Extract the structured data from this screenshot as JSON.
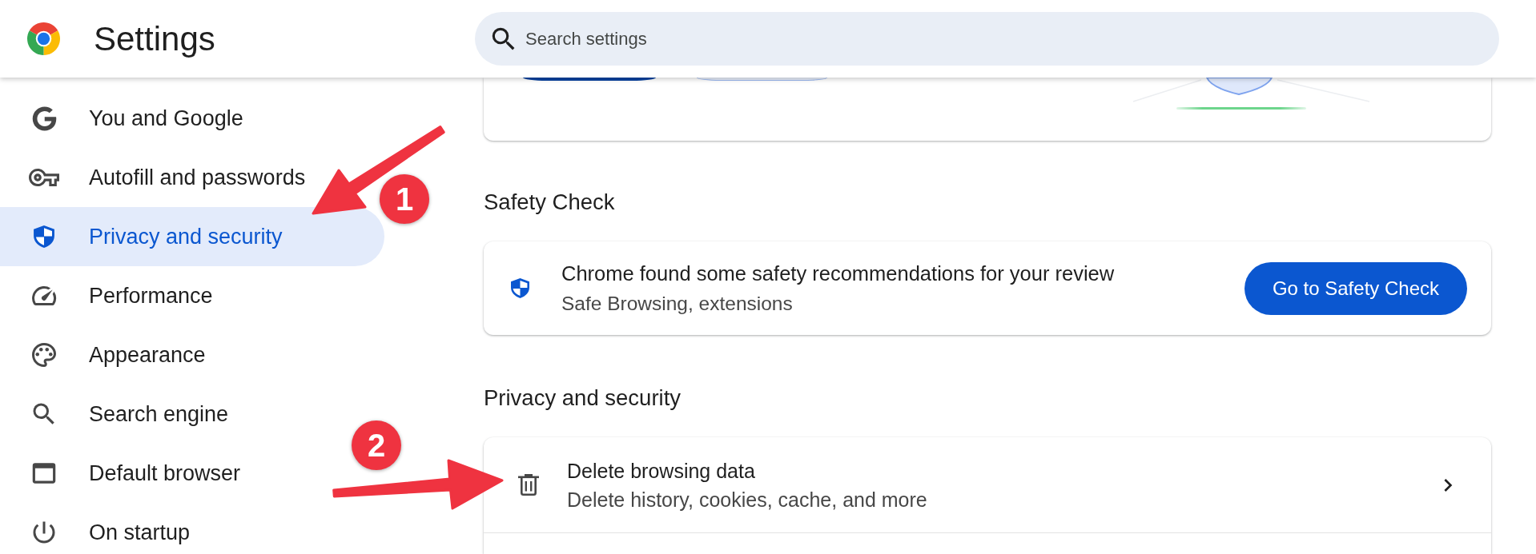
{
  "header": {
    "title": "Settings",
    "search": {
      "placeholder": "Search settings"
    }
  },
  "sidebar": {
    "items": [
      {
        "label": "You and Google",
        "selected": false
      },
      {
        "label": "Autofill and passwords",
        "selected": false
      },
      {
        "label": "Privacy and security",
        "selected": true
      },
      {
        "label": "Performance",
        "selected": false
      },
      {
        "label": "Appearance",
        "selected": false
      },
      {
        "label": "Search engine",
        "selected": false
      },
      {
        "label": "Default browser",
        "selected": false
      },
      {
        "label": "On startup",
        "selected": false
      }
    ]
  },
  "safety_check": {
    "heading": "Safety Check",
    "card": {
      "title": "Chrome found some safety recommendations for your review",
      "subtitle": "Safe Browsing, extensions",
      "button": "Go to Safety Check"
    }
  },
  "privacy_and_security": {
    "heading": "Privacy and security",
    "rows": [
      {
        "title": "Delete browsing data",
        "subtitle": "Delete history, cookies, cache, and more"
      }
    ]
  },
  "annotations": [
    {
      "label": "1"
    },
    {
      "label": "2"
    }
  ]
}
